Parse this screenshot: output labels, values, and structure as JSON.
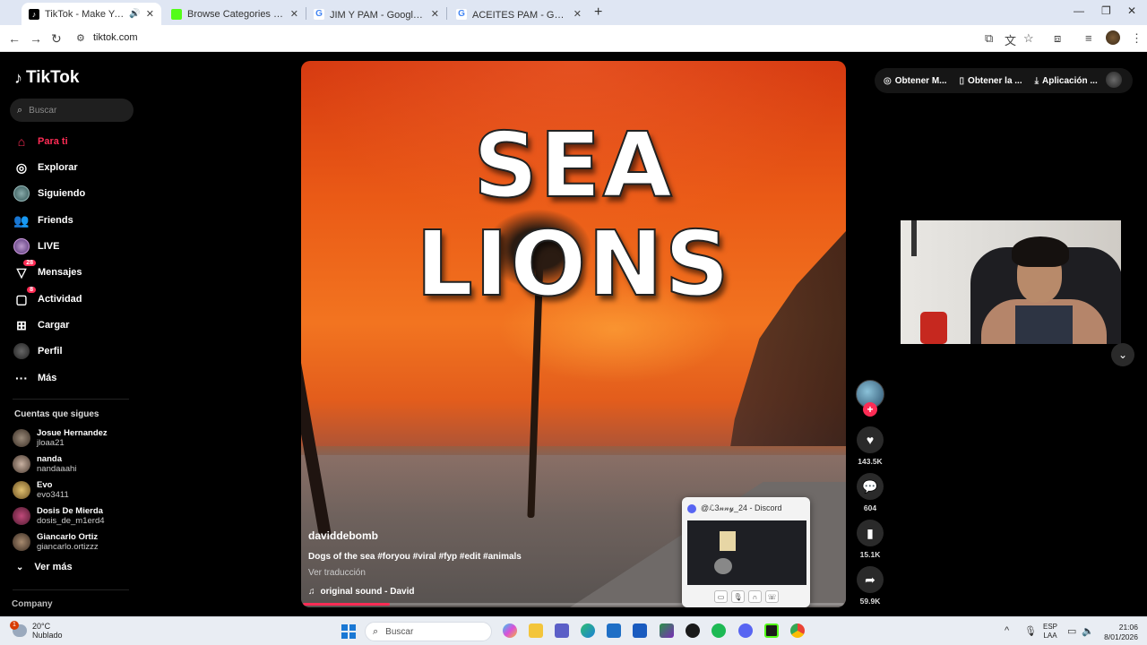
{
  "browser": {
    "tabs": [
      {
        "title": "TikTok - Make Your Day",
        "favicon": "tiktok-icon",
        "color": "#000000",
        "active": true
      },
      {
        "title": "Browse Categories - Kick Stream",
        "favicon": "kick-icon",
        "color": "#53fc18",
        "active": false
      },
      {
        "title": "JIM Y PAM - Google 検索",
        "favicon": "google-icon",
        "color": "#4285f4",
        "active": false
      },
      {
        "title": "ACEITES PAM - Google 検索",
        "favicon": "google-icon",
        "color": "#4285f4",
        "active": false
      }
    ],
    "url": "tiktok.com"
  },
  "sidebar": {
    "brand": "TikTok",
    "search_placeholder": "Buscar",
    "nav": [
      {
        "label": "Para ti",
        "icon": "home-icon",
        "active": true
      },
      {
        "label": "Explorar",
        "icon": "compass-icon"
      },
      {
        "label": "Siguiendo",
        "icon": "following-avatar-icon"
      },
      {
        "label": "Friends",
        "icon": "friends-icon"
      },
      {
        "label": "LIVE",
        "icon": "live-icon"
      },
      {
        "label": "Mensajes",
        "icon": "messages-icon",
        "badge": "28"
      },
      {
        "label": "Actividad",
        "icon": "activity-icon",
        "badge": "8"
      },
      {
        "label": "Cargar",
        "icon": "upload-icon"
      },
      {
        "label": "Perfil",
        "icon": "profile-icon"
      },
      {
        "label": "Más",
        "icon": "more-icon"
      }
    ],
    "following_title": "Cuentas que sigues",
    "following": [
      {
        "name": "Josue Hernandez",
        "handle": "jloaa21"
      },
      {
        "name": "nanda",
        "handle": "nandaaahi"
      },
      {
        "name": "Evo",
        "handle": "evo3411"
      },
      {
        "name": "Dosis De Mierda",
        "handle": "dosis_de_m1erd4"
      },
      {
        "name": "Giancarlo Ortiz",
        "handle": "giancarlo.ortizzz"
      }
    ],
    "see_more": "Ver más",
    "company": "Company"
  },
  "video": {
    "overlay_title": "SEA   LIONS",
    "author": "daviddebomb",
    "description": "Dogs of the sea #foryou #viral #fyp #edit #animals",
    "translate": "Ver traducción",
    "sound": "original sound - David",
    "progress": 0.16
  },
  "actions": {
    "likes": "143.5K",
    "comments": "604",
    "saves": "15.1K",
    "shares": "59.9K"
  },
  "top_buttons": [
    {
      "label": "Obtener M...",
      "icon": "coin-icon"
    },
    {
      "label": "Obtener la ...",
      "icon": "phone-icon"
    },
    {
      "label": "Aplicación ...",
      "icon": "download-icon"
    }
  ],
  "discord": {
    "title": "@ℒ3𝓃𝓃𝓎_24 - Discord"
  },
  "taskbar": {
    "temp": "20°C",
    "weather": "Nublado",
    "weather_badge": "1",
    "search_placeholder": "Buscar",
    "lang_line1": "ESP",
    "lang_line2": "LAA",
    "time": "21:06",
    "date": "8/01/2026"
  }
}
